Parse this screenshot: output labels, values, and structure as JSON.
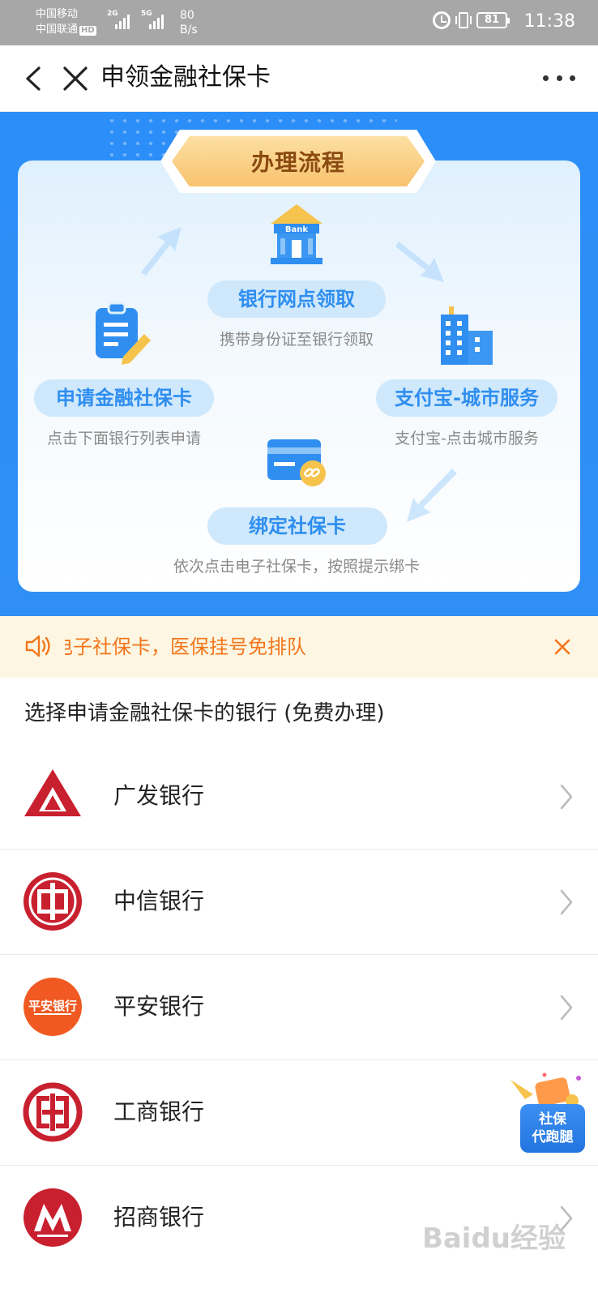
{
  "status_bar": {
    "carrier1": "中国移动",
    "carrier2": "中国联通",
    "hd": "HD",
    "net1": "2G",
    "net2": "5G",
    "speed_value": "80",
    "speed_unit": "B/s",
    "battery": "81",
    "time": "11:38"
  },
  "nav": {
    "title": "申领金融社保卡"
  },
  "process": {
    "title": "办理流程",
    "steps": [
      {
        "label": "银行网点领取",
        "desc": "携带身份证至银行领取"
      },
      {
        "label": "申请金融社保卡",
        "desc": "点击下面银行列表申请"
      },
      {
        "label": "支付宝-城市服务",
        "desc": "支付宝-点击城市服务"
      },
      {
        "label": "绑定社保卡",
        "desc": "依次点击电子社保卡，按照提示绑卡"
      }
    ],
    "bank_icon_text": "Bank"
  },
  "notice": {
    "text": "电子社保卡，医保挂号免排队"
  },
  "list": {
    "title": "选择申请金融社保卡的银行 (免费办理)",
    "banks": [
      {
        "name": "广发银行"
      },
      {
        "name": "中信银行"
      },
      {
        "name": "平安银行",
        "logo_text": "平安银行"
      },
      {
        "name": "工商银行"
      },
      {
        "name": "招商银行"
      }
    ]
  },
  "float": {
    "line1": "社保",
    "line2": "代跑腿"
  },
  "watermark": "Baidu经验",
  "colors": {
    "banner_blue": "#2f8ff6",
    "pill_text": "#2f8ef0",
    "notice_orange": "#f2761c",
    "guangfa_red": "#c8202e",
    "citic_red": "#c8202e",
    "pingan_orange": "#f05a22",
    "icbc_red": "#c8202e",
    "cmb_red": "#c8202e"
  }
}
